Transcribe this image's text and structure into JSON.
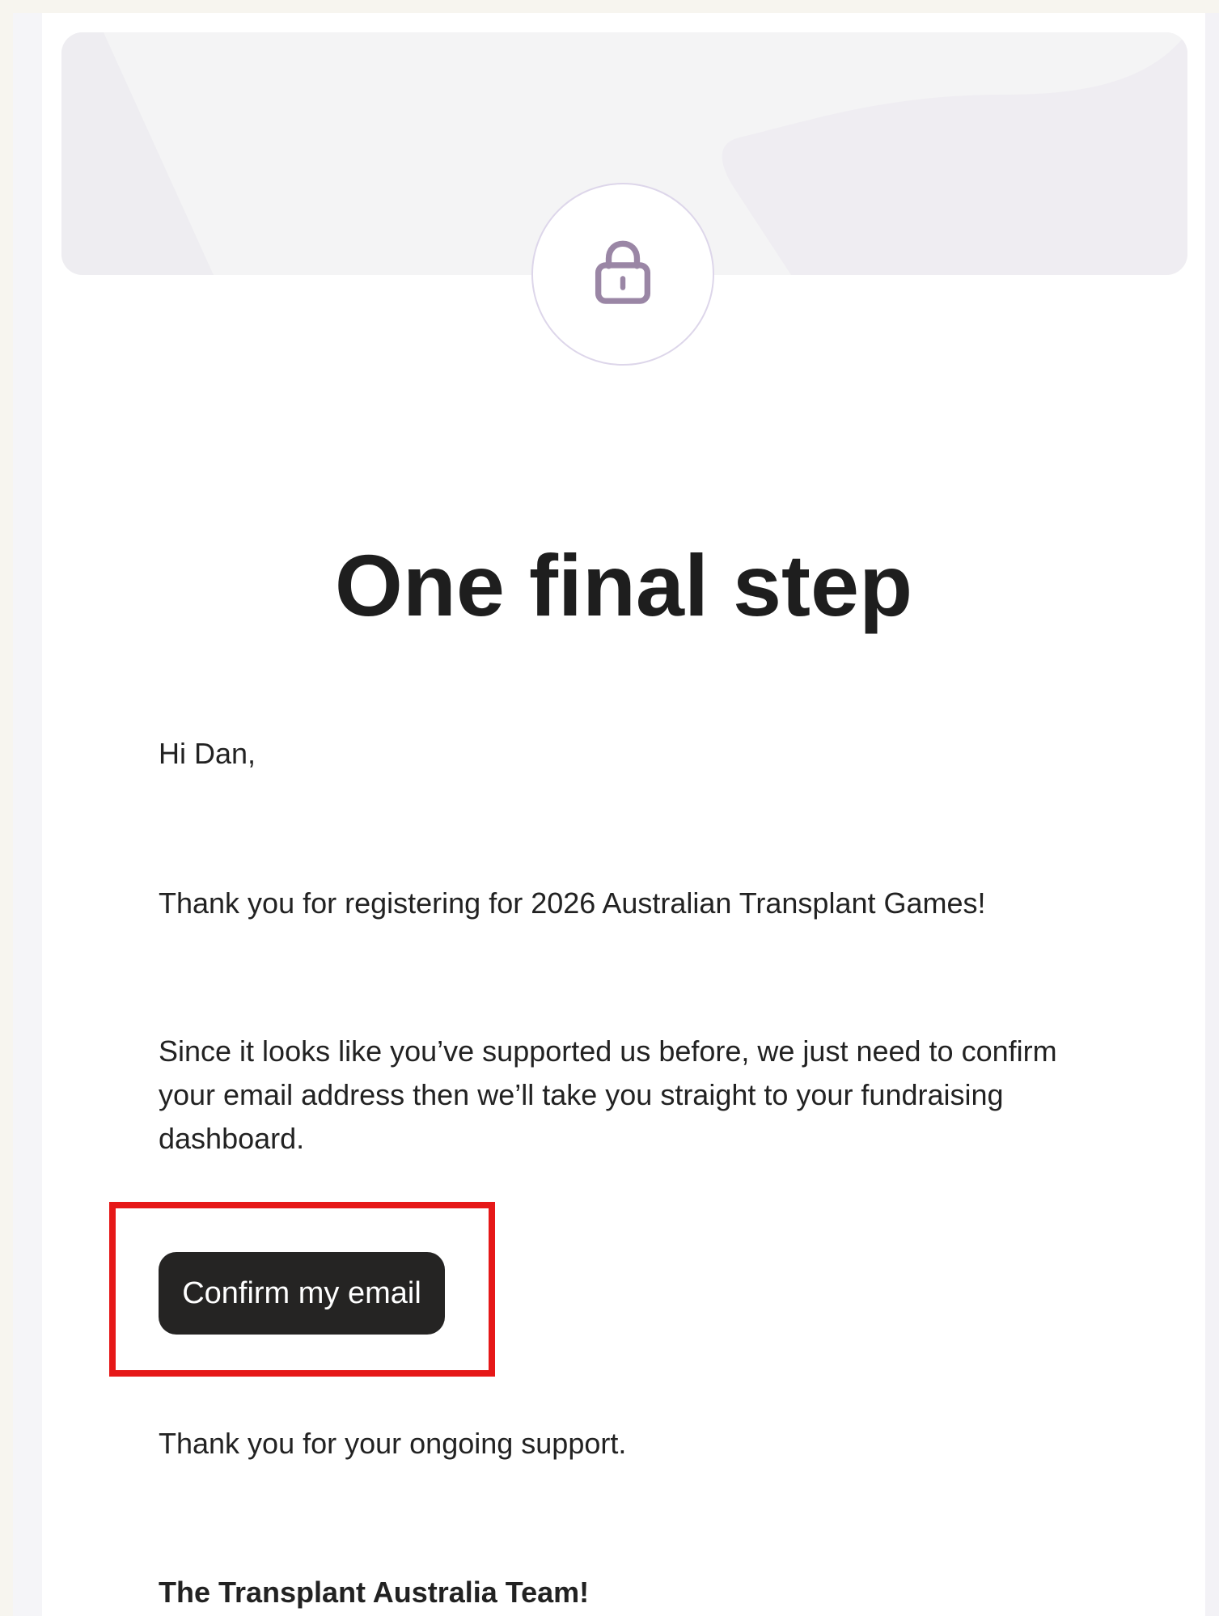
{
  "email": {
    "headline": "One final step",
    "greeting": "Hi Dan,",
    "thanks_registering": "Thank you for registering for 2026 Australian Transplant Games!",
    "supported_before": "Since it looks like you’ve supported us before, we just need to confirm your email address then we’ll take you straight to your fundraising dashboard.",
    "confirm_button": "Confirm my email",
    "ongoing_support": "Thank you for your ongoing support.",
    "signature": "The Transplant Australia Team!"
  },
  "icons": {
    "hero_icon": "lock-icon"
  },
  "colors": {
    "button_background": "#252423",
    "highlight_border": "#e61818",
    "lock_icon": "#9a86a5",
    "hero_background": "#f4f4f5"
  }
}
